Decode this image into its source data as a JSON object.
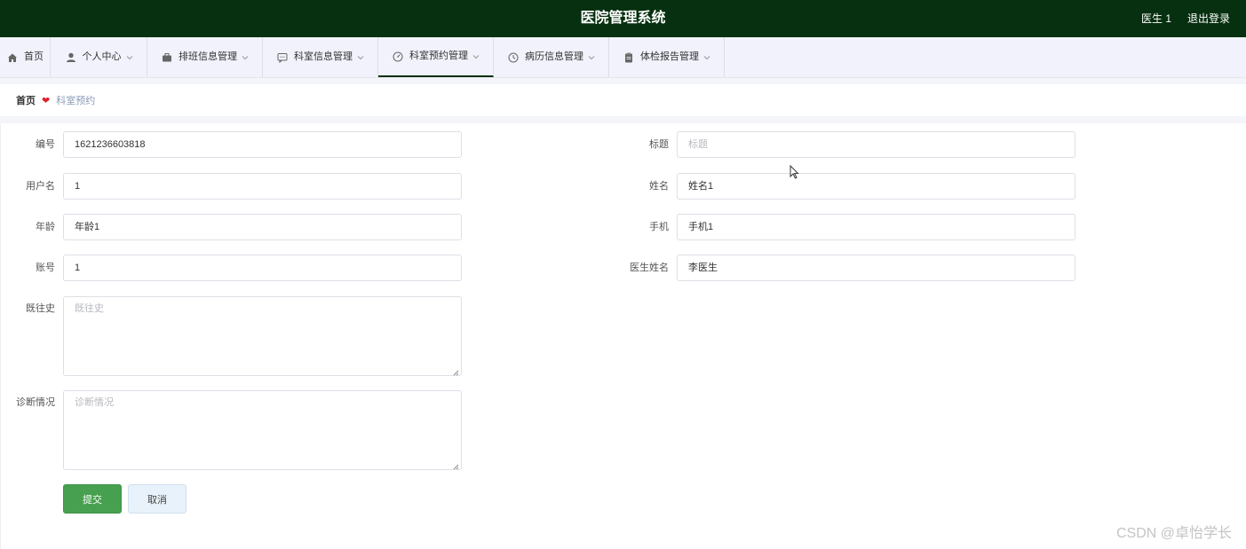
{
  "header": {
    "title": "医院管理系统",
    "user": "医生 1",
    "logout": "退出登录"
  },
  "nav": [
    {
      "label": "首页",
      "icon": "home-icon"
    },
    {
      "label": "个人中心",
      "icon": "user-icon"
    },
    {
      "label": "排班信息管理",
      "icon": "briefcase-icon"
    },
    {
      "label": "科室信息管理",
      "icon": "chat-icon"
    },
    {
      "label": "科室预约管理",
      "icon": "gauge-icon"
    },
    {
      "label": "病历信息管理",
      "icon": "clock-icon"
    },
    {
      "label": "体检报告管理",
      "icon": "clipboard-icon"
    }
  ],
  "breadcrumb": {
    "home": "首页",
    "current": "科室预约"
  },
  "form": {
    "number": {
      "label": "编号",
      "value": "1621236603818"
    },
    "title": {
      "label": "标题",
      "placeholder": "标题"
    },
    "username": {
      "label": "用户名",
      "value": "1"
    },
    "name": {
      "label": "姓名",
      "value": "姓名1"
    },
    "age": {
      "label": "年龄",
      "value": "年龄1"
    },
    "phone": {
      "label": "手机",
      "value": "手机1"
    },
    "account": {
      "label": "账号",
      "value": "1"
    },
    "doctor": {
      "label": "医生姓名",
      "value": "李医生"
    },
    "history": {
      "label": "既往史",
      "placeholder": "既往史"
    },
    "diagnosis": {
      "label": "诊断情况",
      "placeholder": "诊断情况"
    },
    "submit": "提交",
    "cancel": "取消"
  },
  "watermark": "CSDN @卓怡学长"
}
